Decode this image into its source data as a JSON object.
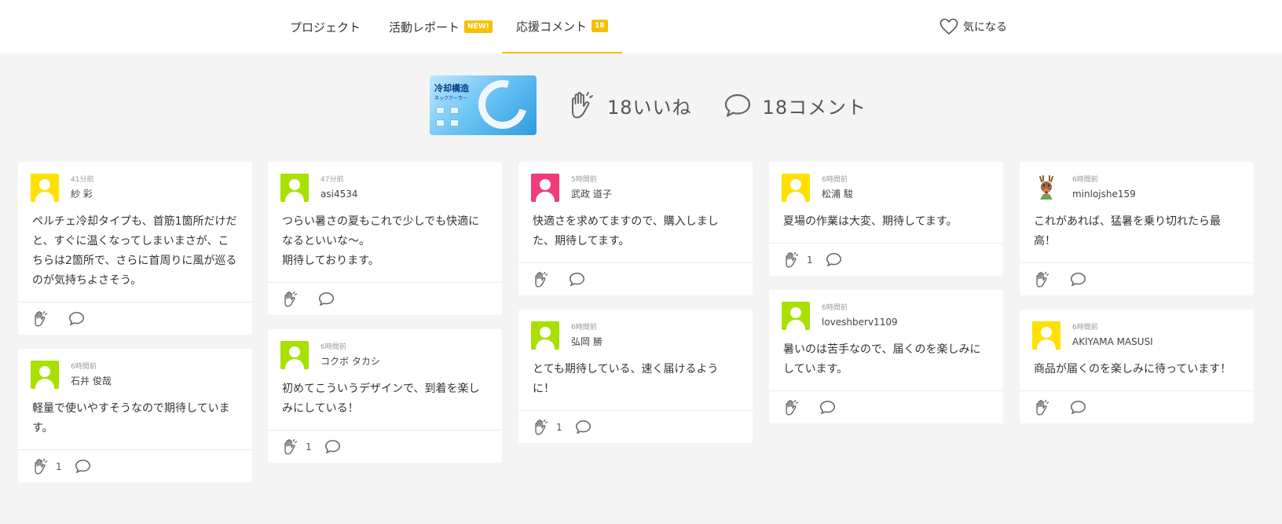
{
  "nav": {
    "tabs": [
      {
        "label": "プロジェクト",
        "badge": ""
      },
      {
        "label": "活動レポート",
        "badge": "NEW!"
      },
      {
        "label": "応援コメント",
        "badge": "18"
      }
    ],
    "favorite_label": "気になる"
  },
  "summary": {
    "likes_label": "18いいね",
    "comments_label": "18コメント",
    "product_image_text": "冷却構造",
    "product_image_subtext": "ネッククーラー"
  },
  "colors": {
    "accent": "#f2c400",
    "badge": "#f5c000",
    "avatar_yellow": "#ffe000",
    "avatar_green": "#a8e000",
    "avatar_pink": "#f03c7a"
  },
  "columns": [
    {
      "cards": [
        {
          "time": "41分前",
          "name": "紗 彩",
          "avatar": "yellow",
          "text": "ペルチェ冷却タイプも、首筋1箇所だけだと、すぐに温くなってしまいまさが、こちらは2箇所で、さらに首周りに風が巡るのが気持ちよさそう。",
          "likes": ""
        },
        {
          "time": "6時間前",
          "name": "石井 俊哉",
          "avatar": "green",
          "text": "軽量で使いやすそうなので期待しています。",
          "likes": "1"
        }
      ]
    },
    {
      "cards": [
        {
          "time": "47分前",
          "name": "asi4534",
          "avatar": "green",
          "text": "つらい暑さの夏もこれで少しでも快適になるといいな〜。\n期待しております。",
          "likes": ""
        },
        {
          "time": "6時間前",
          "name": "コクボ タカシ",
          "avatar": "green",
          "text": "初めてこういうデザインで、到着を楽しみにしている！",
          "likes": "1"
        }
      ]
    },
    {
      "cards": [
        {
          "time": "5時間前",
          "name": "武政 道子",
          "avatar": "pink",
          "text": "快適さを求めてますので、購入しました、期待してます。",
          "likes": ""
        },
        {
          "time": "6時間前",
          "name": "弘岡 勝",
          "avatar": "green",
          "text": "とても期待している、速く届けるように！",
          "likes": "1"
        }
      ]
    },
    {
      "cards": [
        {
          "time": "6時間前",
          "name": "松浦 駿",
          "avatar": "yellow",
          "text": "夏場の作業は大変、期待してます。",
          "likes": "1"
        },
        {
          "time": "6時間前",
          "name": "loveshberv1109",
          "avatar": "green",
          "text": "暑いのは苦手なので、届くのを楽しみにしています。",
          "likes": ""
        }
      ]
    },
    {
      "cards": [
        {
          "time": "6時間前",
          "name": "minlojshe159",
          "avatar": "photo",
          "text": "これがあれば、猛暑を乗り切れたら最高！",
          "likes": ""
        },
        {
          "time": "6時間前",
          "name": "AKIYAMA MASUSI",
          "avatar": "yellow",
          "text": "商品が届くのを楽しみに待っています！",
          "likes": ""
        }
      ]
    }
  ]
}
